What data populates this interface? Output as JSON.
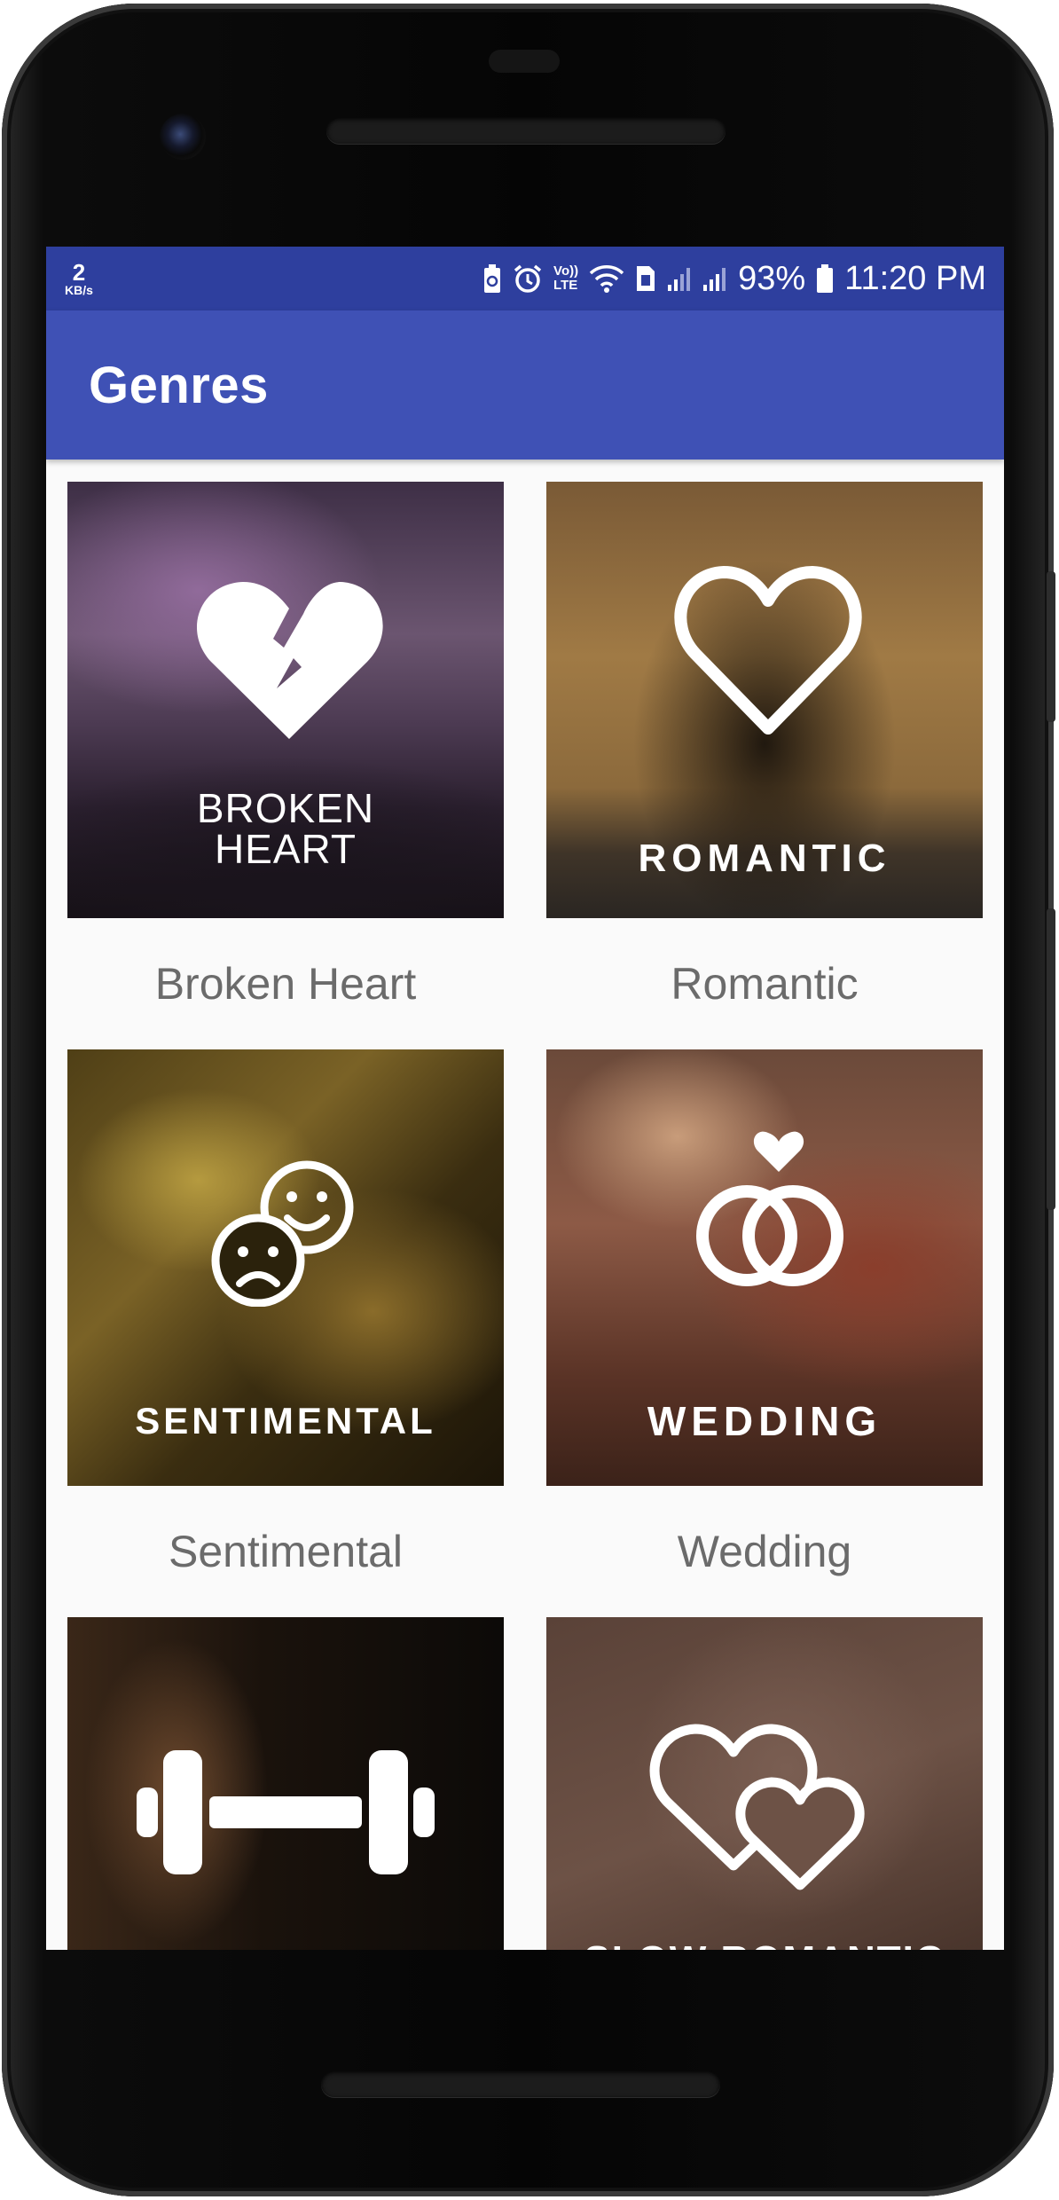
{
  "status_bar": {
    "net_speed": "2",
    "net_speed_unit": "KB/s",
    "volte_top": "Vo))",
    "volte_bottom": "LTE",
    "battery": "93%",
    "time": "11:20 PM"
  },
  "app_bar": {
    "title": "Genres"
  },
  "genres": [
    {
      "name": "Broken Heart",
      "thumb_line1": "BROKEN",
      "thumb_line2": "HEART",
      "icon": "broken-heart-icon"
    },
    {
      "name": "Romantic",
      "thumb_line1": "ROMANTIC",
      "icon": "heart-outline-icon"
    },
    {
      "name": "Sentimental",
      "thumb_line1": "SENTIMENTAL",
      "icon": "happy-sad-faces-icon"
    },
    {
      "name": "Wedding",
      "thumb_line1": "WEDDING",
      "icon": "wedding-rings-icon"
    },
    {
      "icon": "dumbbell-icon"
    },
    {
      "thumb_line1": "SLOW ROMANTIC",
      "icon": "two-hearts-icon"
    }
  ]
}
